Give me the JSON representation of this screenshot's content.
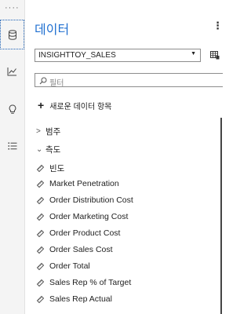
{
  "rail": {
    "dots": "····"
  },
  "panel": {
    "title": "데이터",
    "more": "⋮",
    "source": "INSIGHTTOY_SALES",
    "search_placeholder": "필터",
    "add_item": "새로운 데이터 항목",
    "groups": [
      {
        "label": "범주",
        "expanded": false,
        "chevron": ">"
      },
      {
        "label": "측도",
        "expanded": true,
        "chevron": "⌄"
      }
    ],
    "measures": [
      "빈도",
      "Market Penetration",
      "Order Distribution Cost",
      "Order Marketing Cost",
      "Order Product Cost",
      "Order Sales Cost",
      "Order Total",
      "Sales Rep % of Target",
      "Sales Rep Actual"
    ]
  },
  "colors": {
    "accent": "#1f6fd0",
    "text": "#222222",
    "rail": "#f4f4f4"
  }
}
